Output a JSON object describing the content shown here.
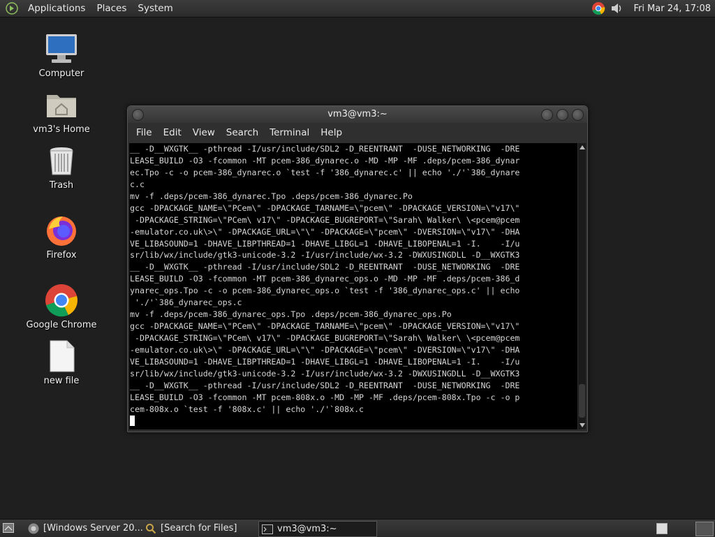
{
  "top_panel": {
    "menus": [
      "Applications",
      "Places",
      "System"
    ],
    "clock": "Fri Mar 24, 17:08",
    "tray_icons": [
      "chrome-icon",
      "volume-icon"
    ]
  },
  "desktop_icons": [
    {
      "label": "Computer",
      "icon": "computer-icon"
    },
    {
      "label": "vm3's Home",
      "icon": "home-folder-icon"
    },
    {
      "label": "Trash",
      "icon": "trash-icon"
    },
    {
      "label": "Firefox",
      "icon": "firefox-icon"
    },
    {
      "label": "Google Chrome",
      "icon": "chrome-icon"
    },
    {
      "label": "new file",
      "icon": "file-icon"
    }
  ],
  "terminal": {
    "title": "vm3@vm3:~",
    "menu": [
      "File",
      "Edit",
      "View",
      "Search",
      "Terminal",
      "Help"
    ],
    "lines": [
      "__ -D__WXGTK__ -pthread -I/usr/include/SDL2 -D_REENTRANT  -DUSE_NETWORKING  -DRE",
      "LEASE_BUILD -O3 -fcommon -MT pcem-386_dynarec.o -MD -MP -MF .deps/pcem-386_dynar",
      "ec.Tpo -c -o pcem-386_dynarec.o `test -f '386_dynarec.c' || echo './'`386_dynare",
      "c.c",
      "mv -f .deps/pcem-386_dynarec.Tpo .deps/pcem-386_dynarec.Po",
      "gcc -DPACKAGE_NAME=\\\"PCem\\\" -DPACKAGE_TARNAME=\\\"pcem\\\" -DPACKAGE_VERSION=\\\"v17\\\"",
      " -DPACKAGE_STRING=\\\"PCem\\ v17\\\" -DPACKAGE_BUGREPORT=\\\"Sarah\\ Walker\\ \\<pcem@pcem",
      "-emulator.co.uk\\>\\\" -DPACKAGE_URL=\\\"\\\" -DPACKAGE=\\\"pcem\\\" -DVERSION=\\\"v17\\\" -DHA",
      "VE_LIBASOUND=1 -DHAVE_LIBPTHREAD=1 -DHAVE_LIBGL=1 -DHAVE_LIBOPENAL=1 -I.    -I/u",
      "sr/lib/wx/include/gtk3-unicode-3.2 -I/usr/include/wx-3.2 -DWXUSINGDLL -D__WXGTK3",
      "__ -D__WXGTK__ -pthread -I/usr/include/SDL2 -D_REENTRANT  -DUSE_NETWORKING  -DRE",
      "LEASE_BUILD -O3 -fcommon -MT pcem-386_dynarec_ops.o -MD -MP -MF .deps/pcem-386_d",
      "ynarec_ops.Tpo -c -o pcem-386_dynarec_ops.o `test -f '386_dynarec_ops.c' || echo",
      " './'`386_dynarec_ops.c",
      "mv -f .deps/pcem-386_dynarec_ops.Tpo .deps/pcem-386_dynarec_ops.Po",
      "gcc -DPACKAGE_NAME=\\\"PCem\\\" -DPACKAGE_TARNAME=\\\"pcem\\\" -DPACKAGE_VERSION=\\\"v17\\\"",
      " -DPACKAGE_STRING=\\\"PCem\\ v17\\\" -DPACKAGE_BUGREPORT=\\\"Sarah\\ Walker\\ \\<pcem@pcem",
      "-emulator.co.uk\\>\\\" -DPACKAGE_URL=\\\"\\\" -DPACKAGE=\\\"pcem\\\" -DVERSION=\\\"v17\\\" -DHA",
      "VE_LIBASOUND=1 -DHAVE_LIBPTHREAD=1 -DHAVE_LIBGL=1 -DHAVE_LIBOPENAL=1 -I.    -I/u",
      "sr/lib/wx/include/gtk3-unicode-3.2 -I/usr/include/wx-3.2 -DWXUSINGDLL -D__WXGTK3",
      "__ -D__WXGTK__ -pthread -I/usr/include/SDL2 -D_REENTRANT  -DUSE_NETWORKING  -DRE",
      "LEASE_BUILD -O3 -fcommon -MT pcem-808x.o -MD -MP -MF .deps/pcem-808x.Tpo -c -o p",
      "cem-808x.o `test -f '808x.c' || echo './'`808x.c"
    ]
  },
  "taskbar": {
    "tasks": [
      {
        "label": "[Windows Server 20...",
        "icon": "chrome-icon"
      },
      {
        "label": "[Search for Files]",
        "icon": "search-icon"
      },
      {
        "label": "vm3@vm3:~",
        "icon": "terminal-icon"
      }
    ]
  },
  "colors": {
    "desktop_bg": "#1f1f1f",
    "terminal_bg": "#000000",
    "terminal_fg": "#d6d6d6"
  }
}
